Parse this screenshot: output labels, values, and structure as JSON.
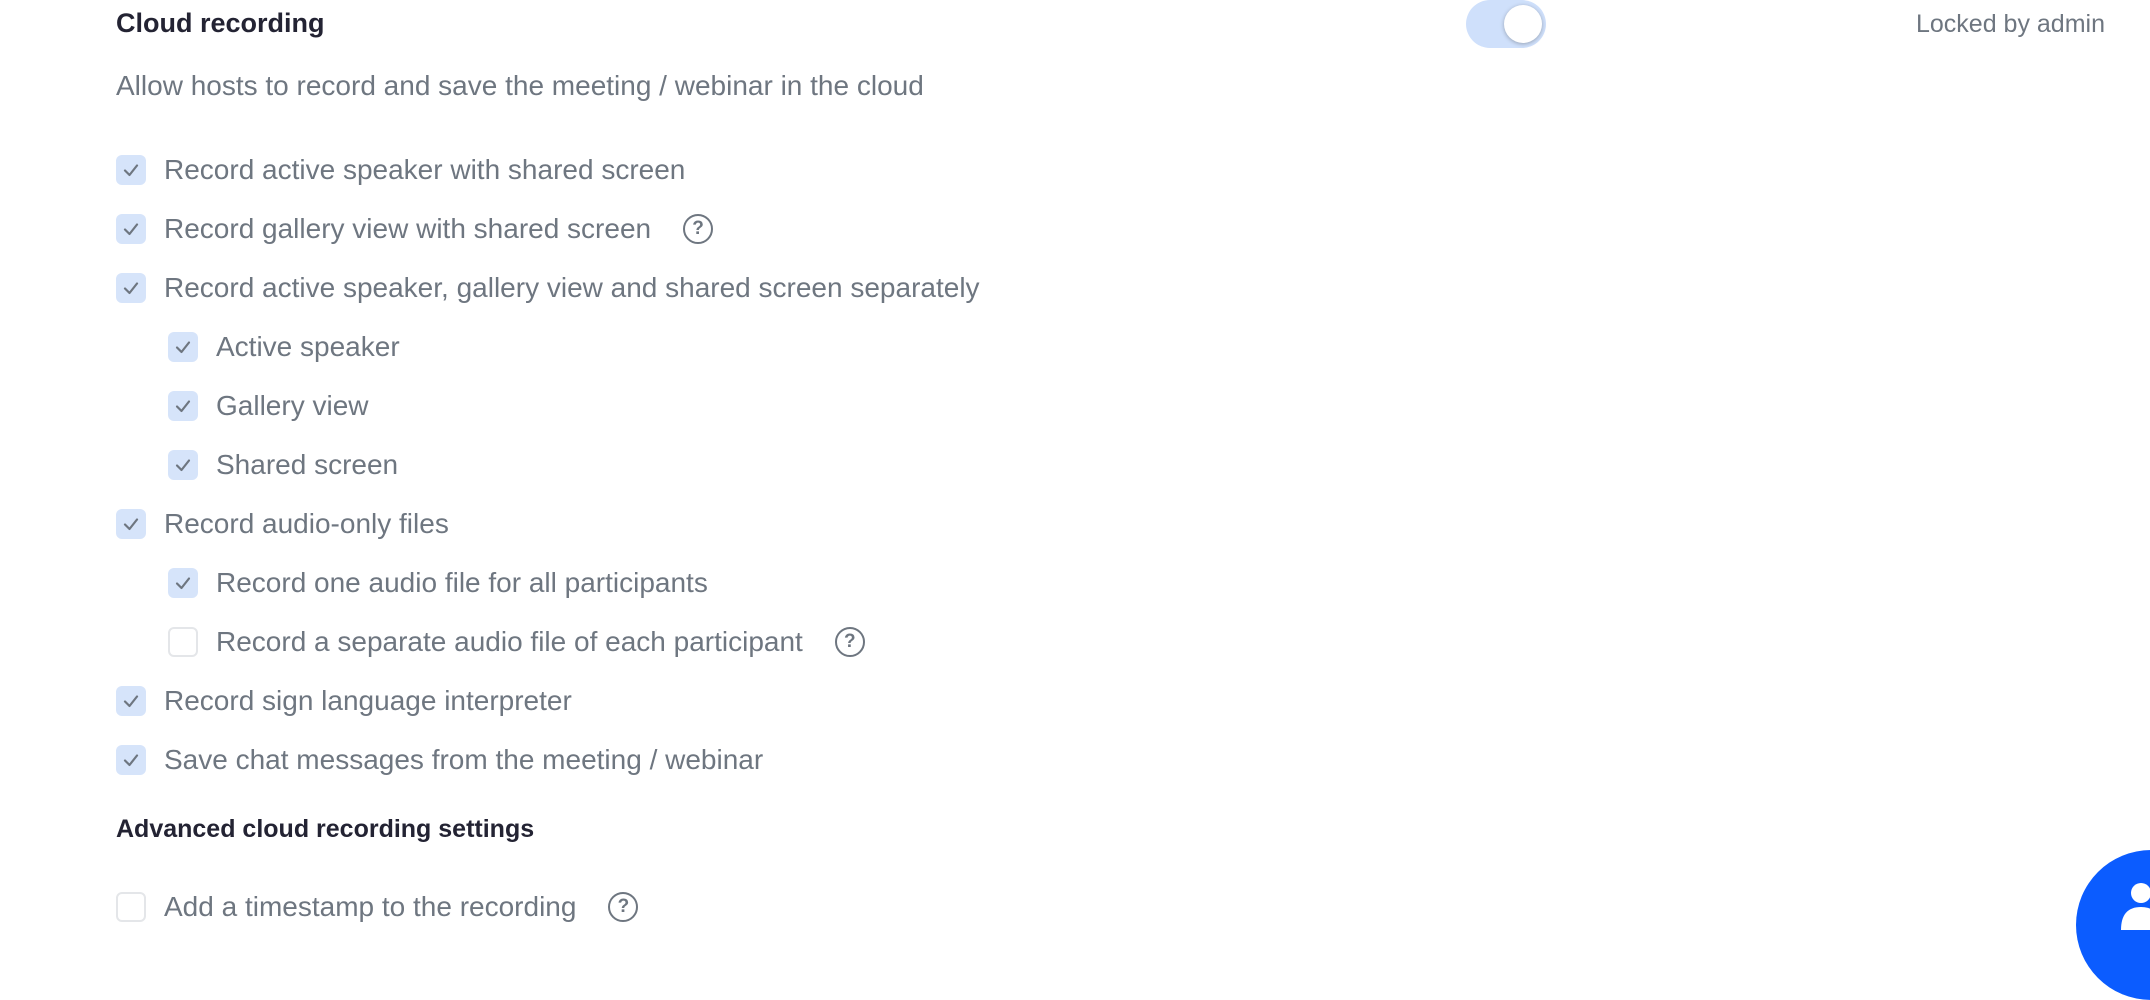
{
  "section": {
    "title": "Cloud recording",
    "description": "Allow hosts to record and save the meeting / webinar in the cloud",
    "toggle_on": true,
    "locked_label": "Locked by admin"
  },
  "options": [
    {
      "label": "Record active speaker with shared screen",
      "checked": true
    },
    {
      "label": "Record gallery view with shared screen",
      "checked": true,
      "help": "?"
    },
    {
      "label": "Record active speaker, gallery view and shared screen separately",
      "checked": true
    },
    {
      "label": "Active speaker",
      "checked": true
    },
    {
      "label": "Gallery view",
      "checked": true
    },
    {
      "label": "Shared screen",
      "checked": true
    },
    {
      "label": "Record audio-only files",
      "checked": true
    },
    {
      "label": "Record one audio file for all participants",
      "checked": true
    },
    {
      "label": "Record a separate audio file of each participant",
      "checked": false,
      "help": "?"
    },
    {
      "label": "Record sign language interpreter",
      "checked": true
    },
    {
      "label": "Save chat messages from the meeting / webinar",
      "checked": true
    }
  ],
  "advanced": {
    "title": "Advanced cloud recording settings",
    "options": [
      {
        "label": "Add a timestamp to the recording",
        "checked": false,
        "help": "?"
      }
    ]
  },
  "icons": {
    "checkmark": "checkmark-icon",
    "help": "question-circle-icon",
    "fab": "user-chat-icon"
  },
  "colors": {
    "accent": "#0b5cff",
    "checkbox_checked_bg": "#d6e4fa",
    "toggle_bg": "#cfe0fb",
    "text": "#6e7680",
    "heading": "#232333"
  }
}
